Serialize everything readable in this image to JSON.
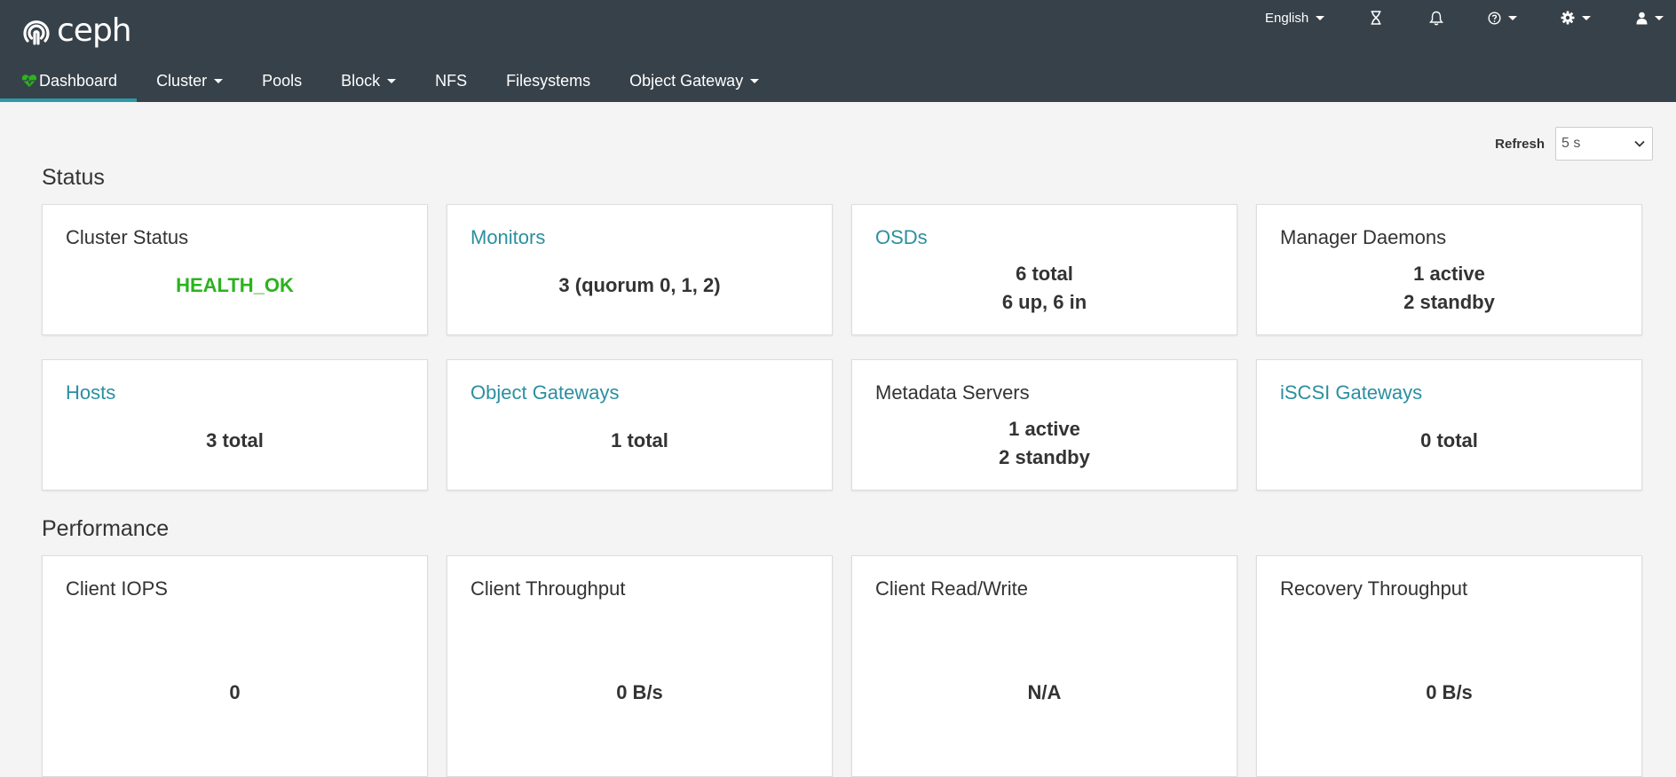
{
  "app": {
    "brand": "ceph"
  },
  "header": {
    "language": "English",
    "icons": [
      "hourglass-icon",
      "bell-icon",
      "help-icon",
      "settings-icon",
      "user-icon"
    ]
  },
  "nav": {
    "dashboard": "Dashboard",
    "cluster": "Cluster",
    "pools": "Pools",
    "block": "Block",
    "nfs": "NFS",
    "filesystems": "Filesystems",
    "object_gateway": "Object Gateway"
  },
  "refresh": {
    "label": "Refresh",
    "value": "5 s"
  },
  "status": {
    "title": "Status",
    "cluster_status": {
      "title": "Cluster Status",
      "value": "HEALTH_OK"
    },
    "monitors": {
      "title": "Monitors",
      "value": "3 (quorum 0, 1, 2)"
    },
    "osds": {
      "title": "OSDs",
      "line1": "6 total",
      "line2": "6 up, 6 in"
    },
    "managers": {
      "title": "Manager Daemons",
      "line1": "1 active",
      "line2": "2 standby"
    },
    "hosts": {
      "title": "Hosts",
      "value": "3 total"
    },
    "object_gateways": {
      "title": "Object Gateways",
      "value": "1 total"
    },
    "mds": {
      "title": "Metadata Servers",
      "line1": "1 active",
      "line2": "2 standby"
    },
    "iscsi": {
      "title": "iSCSI Gateways",
      "value": "0 total"
    }
  },
  "performance": {
    "title": "Performance",
    "client_iops": {
      "title": "Client IOPS",
      "value": "0"
    },
    "client_throughput": {
      "title": "Client Throughput",
      "value": "0 B/s"
    },
    "client_rw": {
      "title": "Client Read/Write",
      "value": "N/A"
    },
    "recovery_throughput": {
      "title": "Recovery Throughput",
      "value": "0 B/s"
    }
  },
  "colors": {
    "navbar": "#374149",
    "accent": "#2b99a8",
    "link": "#2b8fa0",
    "health_ok": "#2bb31d",
    "background": "#f4f4f4"
  }
}
